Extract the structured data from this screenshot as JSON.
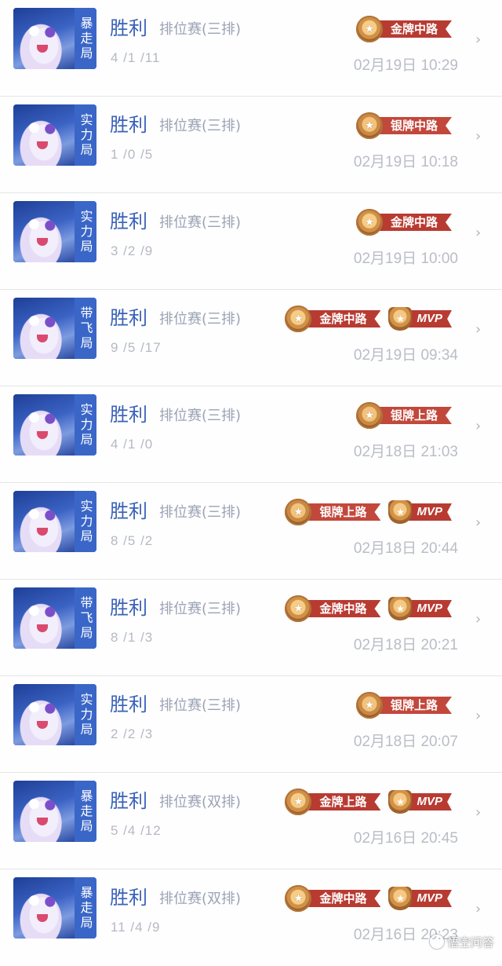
{
  "records": [
    {
      "mode": "暴走局",
      "result": "胜利",
      "queue": "排位赛(三排)",
      "kda": "4 /1 /11",
      "time": "02月19日 10:29",
      "badges": [
        {
          "label": "金牌中路",
          "tier": "gold"
        }
      ],
      "mvp": null
    },
    {
      "mode": "实力局",
      "result": "胜利",
      "queue": "排位赛(三排)",
      "kda": "1 /0 /5",
      "time": "02月19日 10:18",
      "badges": [
        {
          "label": "银牌中路",
          "tier": "silver"
        }
      ],
      "mvp": null
    },
    {
      "mode": "实力局",
      "result": "胜利",
      "queue": "排位赛(三排)",
      "kda": "3 /2 /9",
      "time": "02月19日 10:00",
      "badges": [
        {
          "label": "金牌中路",
          "tier": "gold"
        }
      ],
      "mvp": null
    },
    {
      "mode": "带飞局",
      "result": "胜利",
      "queue": "排位赛(三排)",
      "kda": "9 /5 /17",
      "time": "02月19日 09:34",
      "badges": [
        {
          "label": "金牌中路",
          "tier": "gold"
        }
      ],
      "mvp": "MVP"
    },
    {
      "mode": "实力局",
      "result": "胜利",
      "queue": "排位赛(三排)",
      "kda": "4 /1 /0",
      "time": "02月18日 21:03",
      "badges": [
        {
          "label": "银牌上路",
          "tier": "silver"
        }
      ],
      "mvp": null
    },
    {
      "mode": "实力局",
      "result": "胜利",
      "queue": "排位赛(三排)",
      "kda": "8 /5 /2",
      "time": "02月18日 20:44",
      "badges": [
        {
          "label": "银牌上路",
          "tier": "silver"
        }
      ],
      "mvp": "MVP"
    },
    {
      "mode": "带飞局",
      "result": "胜利",
      "queue": "排位赛(三排)",
      "kda": "8 /1 /3",
      "time": "02月18日 20:21",
      "badges": [
        {
          "label": "金牌中路",
          "tier": "gold"
        }
      ],
      "mvp": "MVP"
    },
    {
      "mode": "实力局",
      "result": "胜利",
      "queue": "排位赛(三排)",
      "kda": "2 /2 /3",
      "time": "02月18日 20:07",
      "badges": [
        {
          "label": "银牌上路",
          "tier": "silver"
        }
      ],
      "mvp": null
    },
    {
      "mode": "暴走局",
      "result": "胜利",
      "queue": "排位赛(双排)",
      "kda": "5 /4 /12",
      "time": "02月16日 20:45",
      "badges": [
        {
          "label": "金牌上路",
          "tier": "gold"
        }
      ],
      "mvp": "MVP"
    },
    {
      "mode": "暴走局",
      "result": "胜利",
      "queue": "排位赛(双排)",
      "kda": "11 /4 /9",
      "time": "02月16日 20:23",
      "badges": [
        {
          "label": "金牌中路",
          "tier": "gold"
        }
      ],
      "mvp": "MVP"
    }
  ],
  "icons": {
    "chevron": "chevron-right-icon",
    "medal": "medal-icon",
    "trophy": "trophy-icon",
    "avatar": "hero-avatar"
  },
  "colors": {
    "result": "#3a62b8",
    "mode_tag": "#3a66c8",
    "ribbon": "#b83b32",
    "medal": "#d09048"
  },
  "watermark": "悟空问答"
}
